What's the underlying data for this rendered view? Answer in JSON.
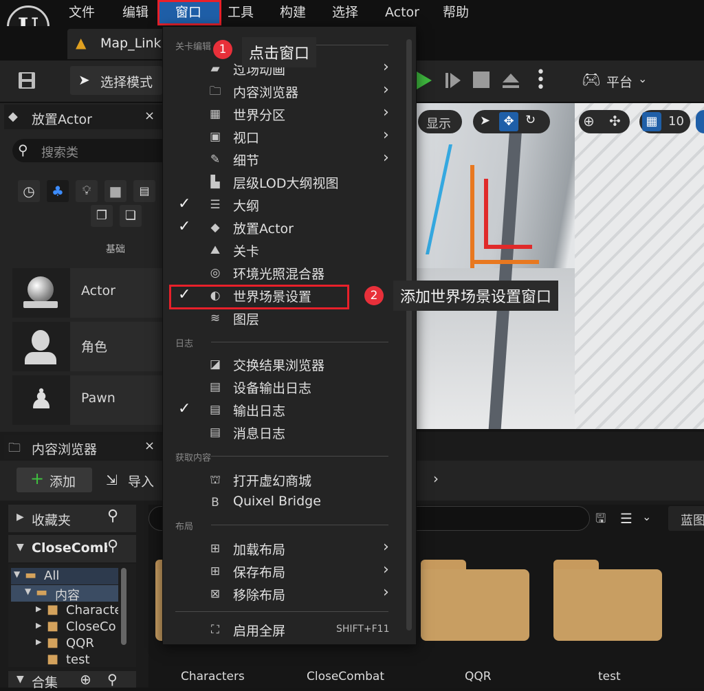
{
  "menubar": {
    "items": [
      "文件",
      "编辑",
      "窗口",
      "工具",
      "构建",
      "选择",
      "Actor",
      "帮助"
    ]
  },
  "tab": {
    "title": "Map_Link"
  },
  "toolbar": {
    "select_mode": "选择模式",
    "platform": "平台"
  },
  "viewport": {
    "show_label": "显示",
    "grid_value": "10"
  },
  "place_actors": {
    "title": "放置Actor",
    "search_placeholder": "搜索类",
    "category_label": "基础",
    "items": [
      "Actor",
      "角色",
      "Pawn"
    ]
  },
  "content_browser": {
    "title": "内容浏览器",
    "add_label": "添加",
    "import_label": "导入",
    "favorites_label": "收藏夹",
    "project_label": "CloseComb",
    "tree": [
      "All",
      "内容",
      "Characte",
      "CloseCo",
      "QQR",
      "test"
    ],
    "collections_label": "合集",
    "filter_label": "蓝图",
    "folders": [
      "Characters",
      "CloseCombat",
      "QQR",
      "test"
    ]
  },
  "window_menu": {
    "sections": {
      "level_editor": "关卡编辑",
      "log": "日志",
      "get_content": "获取内容",
      "layout": "布局"
    },
    "items": [
      {
        "label": "过场动画",
        "icon": "clapper-icon",
        "checked": false,
        "submenu": true
      },
      {
        "label": "内容浏览器",
        "icon": "folder-search-icon",
        "checked": false,
        "submenu": true
      },
      {
        "label": "世界分区",
        "icon": "grid-icon",
        "checked": false,
        "submenu": true
      },
      {
        "label": "视口",
        "icon": "viewport-icon",
        "checked": false,
        "submenu": true
      },
      {
        "label": "细节",
        "icon": "pencil-icon",
        "checked": false,
        "submenu": true
      },
      {
        "label": "层级LOD大纲视图",
        "icon": "lod-icon",
        "checked": false,
        "submenu": false
      },
      {
        "label": "大纲",
        "icon": "outliner-icon",
        "checked": true,
        "submenu": false
      },
      {
        "label": "放置Actor",
        "icon": "place-actor-icon",
        "checked": true,
        "submenu": false
      },
      {
        "label": "关卡",
        "icon": "level-icon",
        "checked": false,
        "submenu": false
      },
      {
        "label": "环境光照混合器",
        "icon": "env-light-icon",
        "checked": false,
        "submenu": false
      },
      {
        "label": "世界场景设置",
        "icon": "globe-icon",
        "checked": true,
        "submenu": false
      },
      {
        "label": "图层",
        "icon": "layers-icon",
        "checked": false,
        "submenu": false
      }
    ],
    "log_items": [
      {
        "label": "交换结果浏览器",
        "icon": "interchange-icon",
        "checked": false
      },
      {
        "label": "设备输出日志",
        "icon": "device-log-icon",
        "checked": false
      },
      {
        "label": "输出日志",
        "icon": "output-log-icon",
        "checked": true
      },
      {
        "label": "消息日志",
        "icon": "message-log-icon",
        "checked": false
      }
    ],
    "content_items": [
      {
        "label": "打开虚幻商城",
        "icon": "store-icon"
      },
      {
        "label": "Quixel Bridge",
        "icon": "bridge-icon"
      }
    ],
    "layout_items": [
      {
        "label": "加载布局",
        "icon": "load-layout-icon"
      },
      {
        "label": "保存布局",
        "icon": "save-layout-icon"
      },
      {
        "label": "移除布局",
        "icon": "remove-layout-icon"
      }
    ],
    "fullscreen": {
      "label": "启用全屏",
      "shortcut": "SHIFT+F11"
    }
  },
  "callouts": [
    {
      "number": "1",
      "text": "点击窗口"
    },
    {
      "number": "2",
      "text": "添加世界场景设置窗口"
    }
  ],
  "colors": {
    "highlight_red": "#e8202a",
    "callout_red": "#e8303a",
    "accent_blue": "#1f5fa8"
  }
}
